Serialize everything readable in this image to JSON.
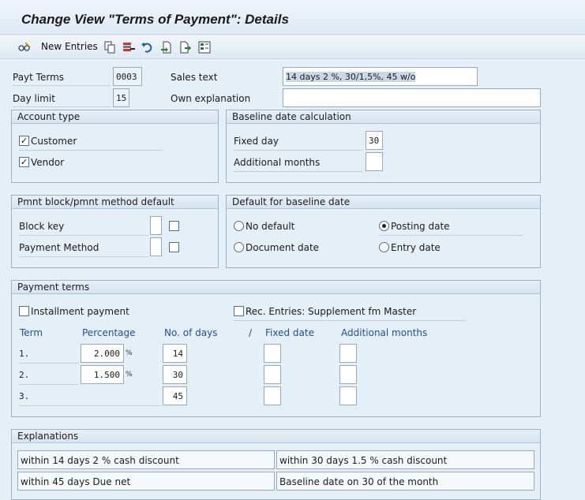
{
  "title": "Change View \"Terms of Payment\": Details",
  "toolbar": {
    "new_entries": "New Entries",
    "icons": [
      "edit-glasses-icon",
      "copy-icon",
      "delete-icon",
      "undo-icon",
      "import-icon",
      "transport-icon",
      "select-icon"
    ]
  },
  "header": {
    "payt_terms_label": "Payt Terms",
    "payt_terms_value": "0003",
    "day_limit_label": "Day limit",
    "day_limit_value": "15",
    "sales_text_label": "Sales text",
    "sales_text_value": "14 days 2 %, 30/1,5%, 45 w/o",
    "own_explanation_label": "Own explanation",
    "own_explanation_value": ""
  },
  "account_type": {
    "title": "Account type",
    "customer_label": "Customer",
    "customer_checked": true,
    "vendor_label": "Vendor",
    "vendor_checked": true
  },
  "baseline_calc": {
    "title": "Baseline date calculation",
    "fixed_day_label": "Fixed day",
    "fixed_day_value": "30",
    "additional_months_label": "Additional months",
    "additional_months_value": ""
  },
  "pmnt_block": {
    "title": "Pmnt block/pmnt method default",
    "block_key_label": "Block key",
    "payment_method_label": "Payment Method"
  },
  "default_baseline": {
    "title": "Default for baseline date",
    "no_default": "No default",
    "posting_date": "Posting date",
    "document_date": "Document date",
    "entry_date": "Entry date",
    "selected": "posting_date"
  },
  "payment_terms": {
    "title": "Payment terms",
    "installment_label": "Installment payment",
    "rec_entries_label": "Rec. Entries: Supplement fm Master",
    "col_term": "Term",
    "col_percentage": "Percentage",
    "col_days": "No. of days",
    "col_slash": "/",
    "col_fixed_date": "Fixed date",
    "col_additional_months": "Additional months",
    "percent_sign": "%",
    "rows": [
      {
        "term": "1.",
        "percentage": "2.000",
        "days": "14"
      },
      {
        "term": "2.",
        "percentage": "1.500",
        "days": "30"
      },
      {
        "term": "3.",
        "percentage": "",
        "days": "45"
      }
    ]
  },
  "explanations": {
    "title": "Explanations",
    "lines": [
      "within 14 days 2 % cash discount",
      "within 30 days 1.5 % cash discount",
      "within 45 days Due net",
      "Baseline date on 30 of the month"
    ]
  }
}
